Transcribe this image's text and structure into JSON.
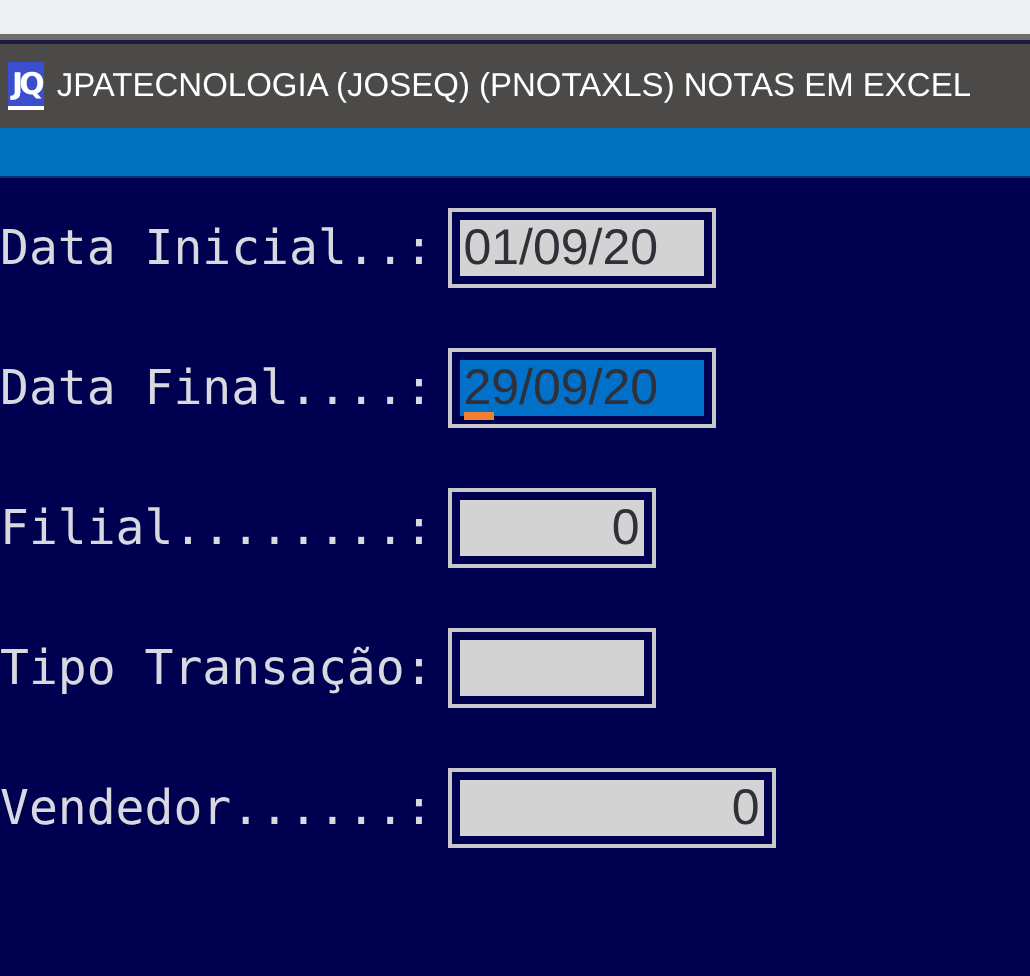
{
  "window": {
    "title": "JPATECNOLOGIA (JOSEQ) (PNOTAXLS) NOTAS EM EXCEL",
    "logo": "JQ"
  },
  "fields": [
    {
      "label": "Data Inicial..:",
      "kind": "date",
      "value": "01/09/20",
      "selected": false
    },
    {
      "label": "Data Final....:",
      "kind": "date",
      "value": "29/09/20",
      "selected": true
    },
    {
      "label": "Filial........:",
      "kind": "code",
      "value": "0",
      "selected": false
    },
    {
      "label": "Tipo Transação:",
      "kind": "text",
      "selected": false
    },
    {
      "label": "Vendedor......:",
      "kind": "id",
      "value": "0",
      "selected": false
    }
  ]
}
